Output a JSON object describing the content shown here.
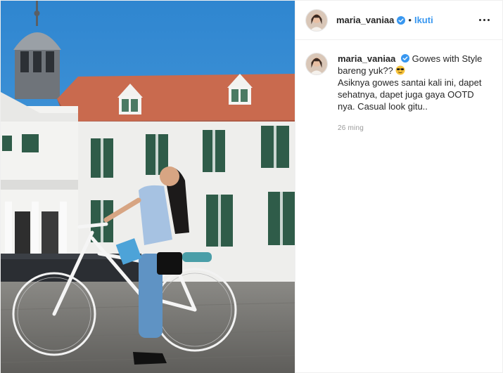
{
  "post": {
    "username": "maria_vaniaa",
    "separator": "•",
    "follow_label": "Ikuti",
    "more_icon": "more-options-icon",
    "verified_icon": "verified-badge-icon",
    "caption": {
      "username": "maria_vaniaa",
      "line1": "Gowes with Style bareng yuk??",
      "emoji_icon": "sunglasses-emoji-icon",
      "body": "Asiknya gowes santai kali ini, dapet sehatnya, dapet juga gaya OOTD nya. Casual look gitu..",
      "timestamp": "26 ming"
    }
  },
  "colors": {
    "link_blue": "#3897f0",
    "text": "#262626",
    "muted": "#999999",
    "sky": "#3a8fd4"
  }
}
